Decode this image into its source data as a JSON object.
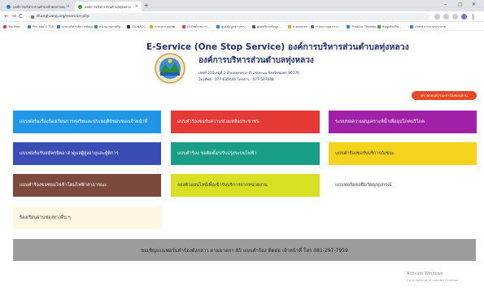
{
  "browser": {
    "tabs": [
      {
        "label": "องค์การบริหารส่วนตำบลห้วยปลาหลด",
        "favicon_color": "#2b7bd8"
      },
      {
        "label": "องค์การบริหารส่วนตำบลทุ่งหลวง",
        "favicon_color": "#3b9a3b"
      }
    ],
    "new_tab": "+",
    "controls": {
      "minimize": "–",
      "maximize": "□",
      "close": "✕"
    },
    "nav": {
      "back": "←",
      "forward": "→",
      "reload": "C"
    },
    "url": "thungluang.org/eservice.php",
    "bookmarks": [
      {
        "label": "YouTube",
        "color": "#e53935"
      },
      {
        "label": "Pnt. NACC TTA",
        "color": "#2b7bd8"
      },
      {
        "label": "ระบบบริหารจัดการข้อมูล...",
        "color": "#2b7bd8"
      },
      {
        "label": "หน่วยงานภาครัฐ...",
        "color": "#3b9a3b"
      },
      {
        "label": "ITA-NACC",
        "color": "#333333"
      },
      {
        "label": "ระบบสารสนเทศ...",
        "color": "#f0a020"
      },
      {
        "label": "เว็บไซต์ราชการ...",
        "color": "#e53935"
      },
      {
        "label": "ศูนย์ข้อมูลข่าวสาร...",
        "color": "#2b7bd8"
      },
      {
        "label": "ศูนย์บริการข้อมูล...",
        "color": "#555555"
      },
      {
        "label": "e-saraban",
        "color": "#f0a020"
      },
      {
        "label": "ระบบงานบุคลากร...",
        "color": "#7e57c2"
      },
      {
        "label": "ThaiGov Thaiday",
        "color": "#2b7bd8"
      },
      {
        "label": "ข้อมูลท้องถิ่น...",
        "color": "#3b9a3b"
      },
      {
        "label": "Grant จากภาคประชาชน",
        "color": "#2b7bd8"
      }
    ]
  },
  "header": {
    "site_title": "E-Service (One Stop Service) องค์การบริหารส่วนตำบลทุ่งหลวง",
    "org_name": "องค์การบริหารส่วนตำบลทุ่งหลวง",
    "address": "เลขที่ 210 หมู่ที่ 2 ตำบลทุ่งหลวง อำเภอละแม จังหวัดชุมพร 86170",
    "phone": "โทรศัพท์ : 077-630444 โทรสาร : 077-507648"
  },
  "track_button": "ตรวจสอบสถานะคำร้องของท่าน",
  "services": [
    {
      "label": "แบบฟอร์มเรื่องร้องเรียนการทุจริตและประพฤติมิชอบของเจ้าหน้าที่",
      "bg": "#1f97e6",
      "fg": "#ffffff"
    },
    {
      "label": "แบบคำร้องขอรับความช่วยเหลือประชาชน",
      "bg": "#e53935",
      "fg": "#ffffff"
    },
    {
      "label": "ระบบขอความอนุเคราะห์น้ำเพื่ออุปโภคบริโภค",
      "bg": "#a020a8",
      "fg": "#ffffff"
    },
    {
      "label": "แบบฟอร์มรับสมัครจิตอาสาดูแลผู้สูงอายุและผู้พิการ",
      "bg": "#3a4db4",
      "fg": "#ffffff"
    },
    {
      "label": "แบบคำร้อง ขอติดตั้ง/ปรับปรุงระบบไฟฟ้า",
      "bg": "#179e84",
      "fg": "#ffffff"
    },
    {
      "label": "แบบคำร้องขอรับบริการถังขยะ",
      "bg": "#f5d21c",
      "fg": "#333333"
    },
    {
      "label": "แบบคำร้องขอซ่อมไฟฟ้าโคมไฟฟ้าสาธารณะ",
      "bg": "#7b4a3c",
      "fg": "#ffffff"
    },
    {
      "label": "จองคิวออนไลน์เพื่อเข้ารับบริการจากหน่วยงาน",
      "bg": "#d7e022",
      "fg": "#333333"
    },
    {
      "label": "แบบฟอร์มขอยืมวัสดุ/อุปกรณ์",
      "bg": "#ffffff",
      "fg": "#333333"
    },
    {
      "label": "ร้องเรียนผ่านช่องทางอื่น ๆ",
      "bg": "#fdf6e3",
      "fg": "#333333"
    }
  ],
  "footer": "ขอเชิญแบบฟอร์มคำร้องดังกล่าว ตามมาตรา 85 แบบคำร้อง ติดต่อ เจ้าหน้าที่ โทร 081-297-7959",
  "watermark": {
    "title": "Activate Windows",
    "subtitle": "Go to Settings to activate Windows."
  }
}
